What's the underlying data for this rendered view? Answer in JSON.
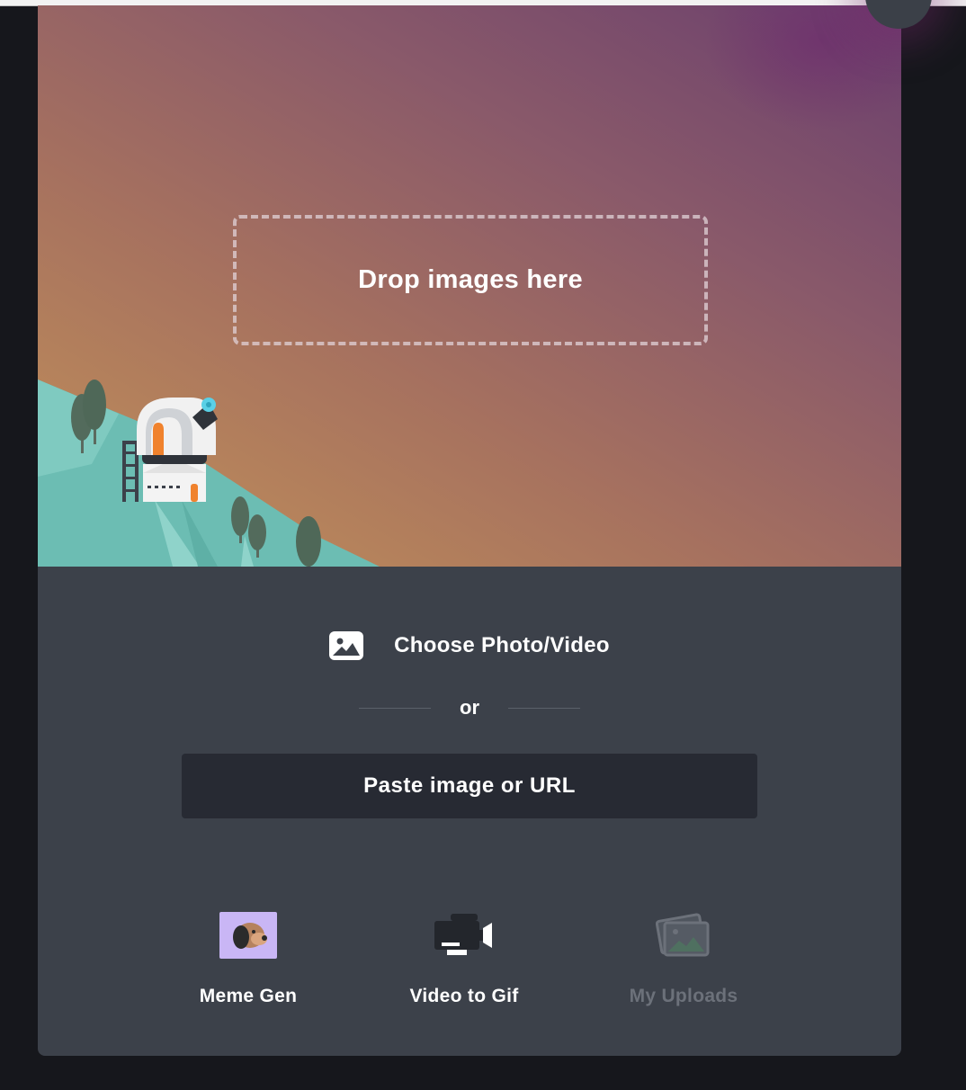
{
  "dropzone": {
    "label": "Drop images here"
  },
  "upload": {
    "choose_label": "Choose Photo/Video",
    "or_label": "or",
    "paste_label": "Paste image or URL"
  },
  "tools": [
    {
      "label": "Meme Gen",
      "icon": "dog-icon",
      "enabled": true
    },
    {
      "label": "Video to Gif",
      "icon": "video-camera-icon",
      "enabled": true
    },
    {
      "label": "My Uploads",
      "icon": "photos-stack-icon",
      "enabled": false
    }
  ],
  "colors": {
    "panel": "#3c414a",
    "input_bg": "#272a33",
    "hero_top": "#6a3f6d",
    "hero_bottom": "#c49358",
    "hill": "#6cbdb3",
    "accent_orange": "#f0822d",
    "disabled_text": "#6c717a"
  }
}
